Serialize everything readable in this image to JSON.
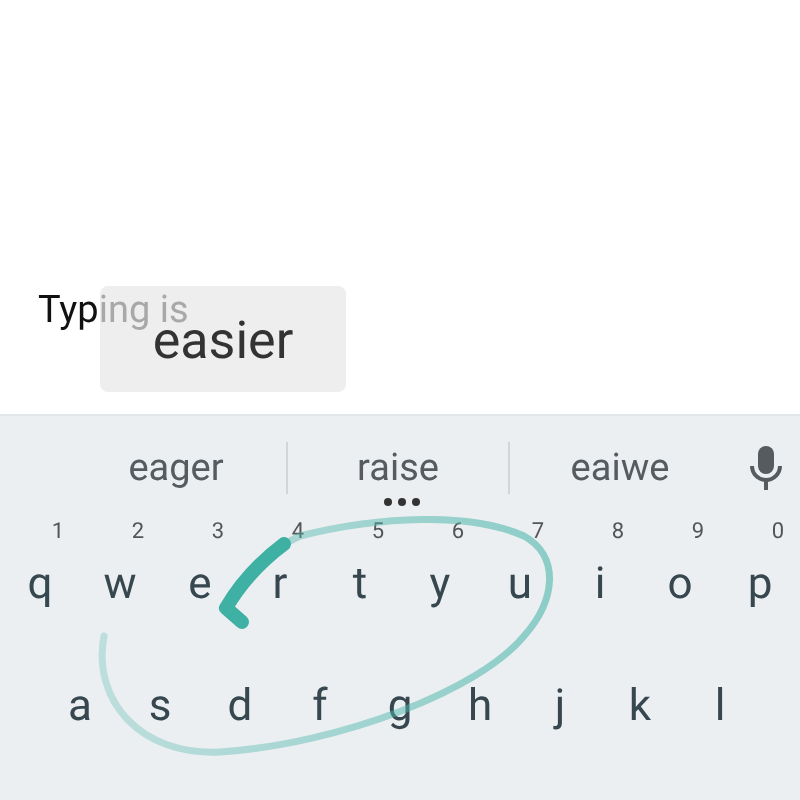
{
  "editor": {
    "committed_text": "Typ",
    "pending_text": "ing is"
  },
  "preview": {
    "word": "easier"
  },
  "suggestions": [
    {
      "text": "eager",
      "more": false
    },
    {
      "text": "raise",
      "more": true
    },
    {
      "text": "eaiwe",
      "more": false
    }
  ],
  "keyboard": {
    "rows": [
      [
        {
          "key": "q",
          "hint": "1"
        },
        {
          "key": "w",
          "hint": "2"
        },
        {
          "key": "e",
          "hint": "3"
        },
        {
          "key": "r",
          "hint": "4"
        },
        {
          "key": "t",
          "hint": "5"
        },
        {
          "key": "y",
          "hint": "6"
        },
        {
          "key": "u",
          "hint": "7"
        },
        {
          "key": "i",
          "hint": "8"
        },
        {
          "key": "o",
          "hint": "9"
        },
        {
          "key": "p",
          "hint": "0"
        }
      ],
      [
        {
          "key": "a"
        },
        {
          "key": "s"
        },
        {
          "key": "d"
        },
        {
          "key": "f"
        },
        {
          "key": "g"
        },
        {
          "key": "h"
        },
        {
          "key": "j"
        },
        {
          "key": "k"
        },
        {
          "key": "l"
        }
      ]
    ]
  }
}
